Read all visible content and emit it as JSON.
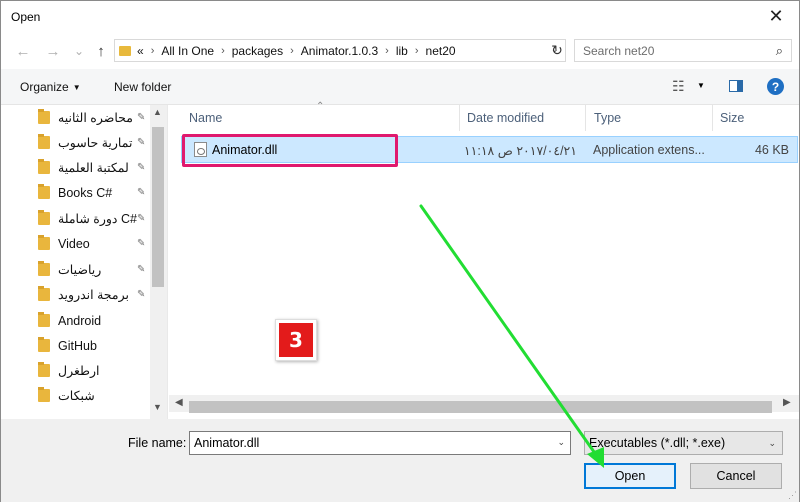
{
  "window": {
    "title": "Open",
    "close_glyph": "✕"
  },
  "nav": {
    "back_glyph": "←",
    "forward_glyph": "→",
    "recent_glyph": "⌄",
    "up_glyph": "↑",
    "breadcrumb": [
      "«",
      "All In One",
      "packages",
      "Animator.1.0.3",
      "lib",
      "net20"
    ],
    "separator": "›",
    "dropdown_glyph": "⌄",
    "refresh_glyph": "↻",
    "search_placeholder": "Search net20",
    "search_glyph": "⌕"
  },
  "toolbar": {
    "organize": "Organize",
    "organize_caret": "▼",
    "new_folder": "New folder",
    "view_glyph": "☷",
    "view_caret": "▼",
    "help_glyph": "?"
  },
  "sidebar": {
    "pin_glyph": "📌",
    "items": [
      {
        "label": "محاضره الثانيه",
        "pinned": true
      },
      {
        "label": "تمارية حاسوب",
        "pinned": true
      },
      {
        "label": "لمكتبة العلمية",
        "pinned": true
      },
      {
        "label": "Books C#",
        "pinned": true
      },
      {
        "label": "دورة شاملة C#",
        "pinned": true
      },
      {
        "label": "Video",
        "pinned": true
      },
      {
        "label": "رياضيات",
        "pinned": true
      },
      {
        "label": "برمجة اندرويد",
        "pinned": true
      },
      {
        "label": "Android",
        "pinned": false
      },
      {
        "label": "GitHub",
        "pinned": false
      },
      {
        "label": "ارطغرل",
        "pinned": false
      },
      {
        "label": "شبكات",
        "pinned": false
      }
    ],
    "scroll_up": "▲",
    "scroll_down": "▼"
  },
  "filelist": {
    "sort_glyph": "⌃",
    "columns": [
      "Name",
      "Date modified",
      "Type",
      "Size"
    ],
    "rows": [
      {
        "name": "Animator.dll",
        "date": "٢٠١٧/٠٤/٢١ ص ١١:١٨",
        "type": "Application extens...",
        "size": "46 KB",
        "selected": true
      }
    ],
    "h_left": "◀",
    "h_right": "▶"
  },
  "annotation": {
    "step_number": "3",
    "badge_color": "#e31b1b",
    "arrow_color": "#22dd33",
    "highlight_color": "#e0196e"
  },
  "bottom": {
    "file_name_label": "File name:",
    "file_name_value": "Animator.dll",
    "file_type_value": "Executables (*.dll; *.exe)",
    "drop_glyph": "⌄",
    "open_label": "Open",
    "cancel_label": "Cancel",
    "grip_glyph": "⋰"
  }
}
